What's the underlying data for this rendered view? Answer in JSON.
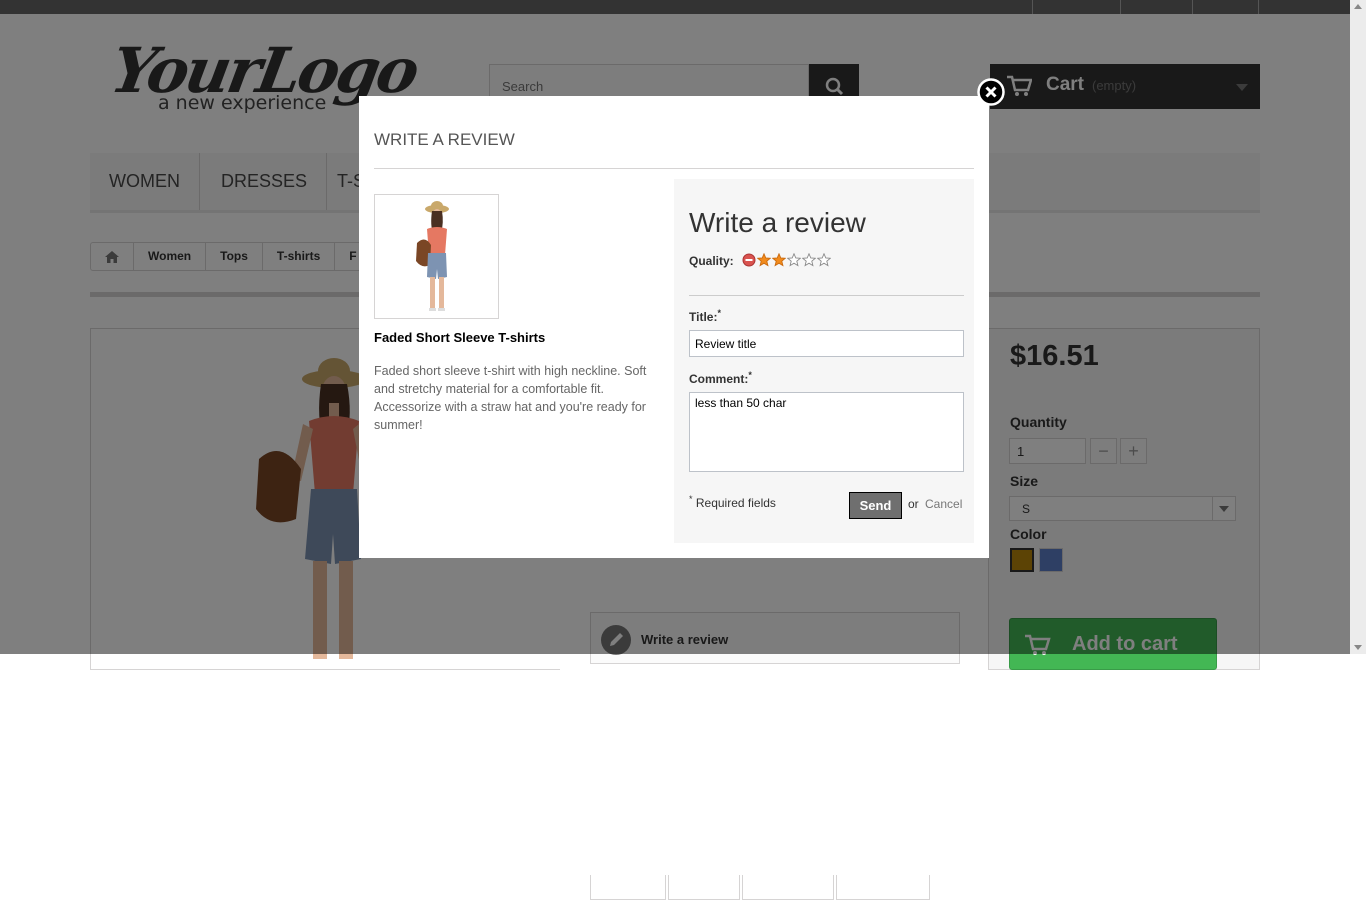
{
  "header": {
    "logo_main": "YourLogo",
    "logo_tagline": "a new experience",
    "search_placeholder": "Search",
    "cart_label": "Cart",
    "cart_status": "(empty)"
  },
  "menu": [
    "WOMEN",
    "DRESSES",
    "T-S"
  ],
  "breadcrumb": [
    "Women",
    "Tops",
    "T-shirts",
    "F"
  ],
  "buy_box": {
    "price": "$16.51",
    "quantity_label": "Quantity",
    "quantity_value": "1",
    "size_label": "Size",
    "size_value": "S",
    "color_label": "Color",
    "colors": [
      "#b8860b",
      "#5c7fc8"
    ],
    "add_to_cart": "Add to cart"
  },
  "write_review_link": "Write a review",
  "modal": {
    "heading": "WRITE A REVIEW",
    "product_name": "Faded Short Sleeve T-shirts",
    "product_description": "Faded short sleeve t-shirt with high neckline. Soft and stretchy material for a comfortable fit. Accessorize with a straw hat and you're ready for summer!",
    "form": {
      "title": "Write a review",
      "quality_label": "Quality:",
      "rating": 2,
      "max_rating": 5,
      "title_label": "Title:",
      "title_value": "Review title",
      "comment_label": "Comment:",
      "comment_value": "less than 50 char",
      "required_mark": "*",
      "required_note": "Required fields",
      "send_label": "Send",
      "or_text": "or",
      "cancel_label": "Cancel"
    }
  },
  "colors": {
    "star_on": "#f28b1c",
    "cancel_icon": "#d9534f"
  }
}
